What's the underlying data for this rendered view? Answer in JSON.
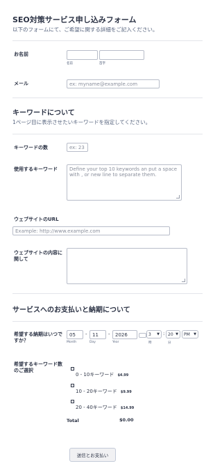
{
  "header": {
    "title": "SEO対策サービス申し込みフォーム",
    "subtitle": "以下のフォームにて、ご希望に関する詳細をご記入ください。"
  },
  "name": {
    "label": "お名前",
    "first_sublabel": "名前",
    "last_sublabel": "苗字"
  },
  "email": {
    "label": "メール",
    "placeholder": "ex: myname@example.com"
  },
  "keywords_section": {
    "title": "キーワードについて",
    "subtitle": "1ページ目に表示させたいキーワードを指定してください。"
  },
  "keyword_count": {
    "label": "キーワードの数",
    "placeholder": "ex: 23"
  },
  "keywords_used": {
    "label": "使用するキーワード",
    "placeholder": "Define your top 10 keywords an put a space with , or new line to separate them."
  },
  "website_url": {
    "label": "ウェブサイトのURL",
    "placeholder": "Example: http://www.example.com"
  },
  "website_content": {
    "label_line1": "ウェブサイトの内容に",
    "label_line2": "関して"
  },
  "payment_section": {
    "title": "サービスへのお支払いと納期について"
  },
  "deadline": {
    "label_line1": "希望する納期はいつで",
    "label_line2": "すか？",
    "month": "05",
    "day": "11",
    "year": "2026",
    "month_label": "Month",
    "day_label": "Day",
    "year_label": "Year",
    "dash": "-",
    "colon": ":",
    "hour": "3",
    "minute": "20",
    "ampm": "PM",
    "hour_label": "時",
    "minute_label": "分"
  },
  "keyword_plan": {
    "label_line1": "希望するキーワード数",
    "label_line2": "のご選択",
    "options": [
      {
        "label": "0 - 10キーワード",
        "price": "$4.99"
      },
      {
        "label": "10 - 20キーワード",
        "price": "$9.99"
      },
      {
        "label": "20 - 40キーワード",
        "price": "$14.99"
      }
    ],
    "total_label": "Total",
    "total_value": "$0.00"
  },
  "submit": {
    "label": "送信とお支払い"
  }
}
